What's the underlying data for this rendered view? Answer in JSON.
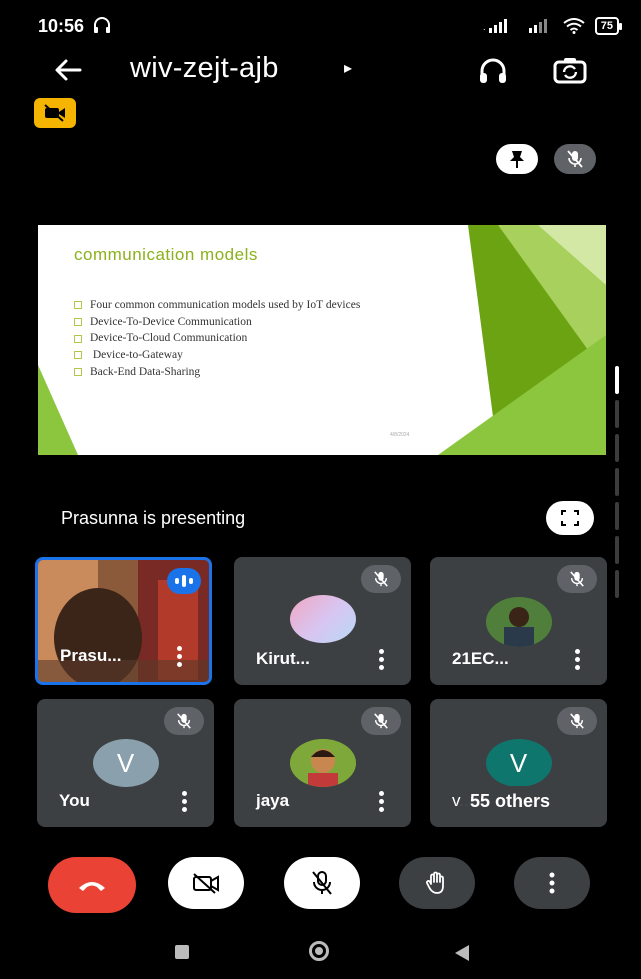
{
  "status_bar": {
    "time": "10:56",
    "battery": "75"
  },
  "header": {
    "meeting_code": "wiv-zejt-ajb",
    "caret": "▸"
  },
  "presentation": {
    "slide_title": "communication models",
    "slide_bullets": [
      "Four common communication models used by IoT devices",
      "Device-To-Device Communication",
      "Device-To-Cloud Communication",
      " Device-to-Gateway",
      "Back-End Data-Sharing"
    ],
    "slide_footer_date": "4/8/2024",
    "presenting_label": "Prasunna is presenting"
  },
  "participants": [
    {
      "name": "Prasu...",
      "speaking": true
    },
    {
      "name": "Kirut...",
      "muted": true
    },
    {
      "name": "21EC...",
      "muted": true
    },
    {
      "name": "You",
      "initial": "V",
      "muted": true
    },
    {
      "name": "jaya",
      "muted": true
    },
    {
      "name": "v...",
      "initial": "V",
      "muted": true,
      "overflow_label": "55 others"
    }
  ],
  "colors": {
    "end_call": "#ea4335",
    "speaking_accent": "#1a73e8",
    "recording_badge": "#f4b400",
    "tile_bg": "#3c4043",
    "avatar_you": "#8aa0ac",
    "avatar_others": "#0f766e",
    "slide_accent": "#8bb11c"
  },
  "icons": {
    "back": "arrow-left-icon",
    "audio": "headphones-icon",
    "switch_camera": "switch-camera-icon",
    "recording": "video-off-badge-icon",
    "pin": "pin-icon",
    "mute": "mic-off-icon",
    "fullscreen": "fullscreen-icon",
    "end_call": "phone-hangup-icon",
    "camera": "camera-off-icon",
    "microphone": "mic-off-icon",
    "raise_hand": "hand-icon",
    "more": "more-vert-icon"
  }
}
